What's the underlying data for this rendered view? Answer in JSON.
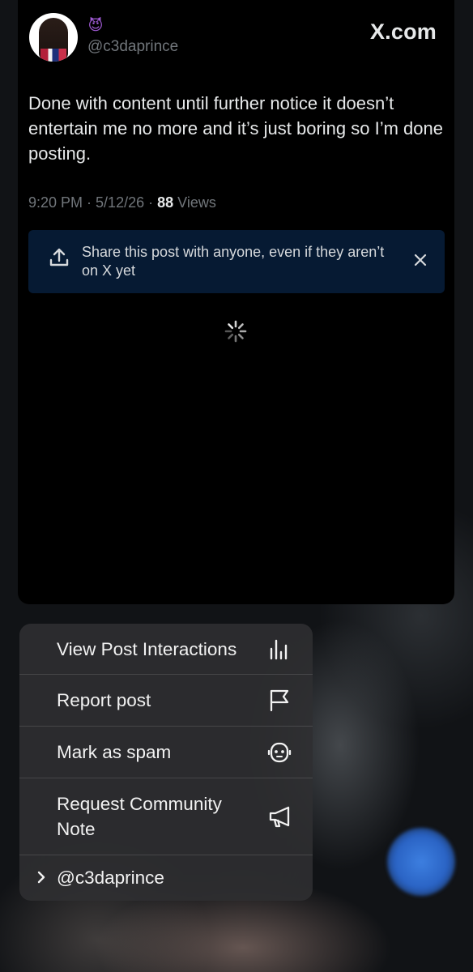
{
  "post": {
    "emoji": "😈",
    "handle": "@c3daprince",
    "brand": "X.com",
    "text": "Done with content until further notice it doesn’t entertain me no more and it’s just boring so I’m done posting.",
    "time": "9:20 PM",
    "date": "5/12/26",
    "separator": " · ",
    "views_count": "88",
    "views_label": " Views"
  },
  "share_banner": {
    "text": "Share this post with anyone, even if they aren’t on X yet",
    "icon": "share-upload-icon",
    "close_icon": "close-icon"
  },
  "menu": {
    "items": [
      {
        "label": "View Post Interactions",
        "icon": "bar-chart-icon"
      },
      {
        "label": "Report post",
        "icon": "flag-icon"
      },
      {
        "label": "Mark as spam",
        "icon": "robot-icon"
      },
      {
        "label": "Request Community Note",
        "icon": "megaphone-icon"
      }
    ],
    "account": {
      "label": "@c3daprince",
      "icon": "chevron-right-icon"
    }
  },
  "colors": {
    "card_bg": "#000000",
    "banner_bg": "#061a33",
    "muted_text": "#71767b",
    "menu_bg": "#303032"
  }
}
